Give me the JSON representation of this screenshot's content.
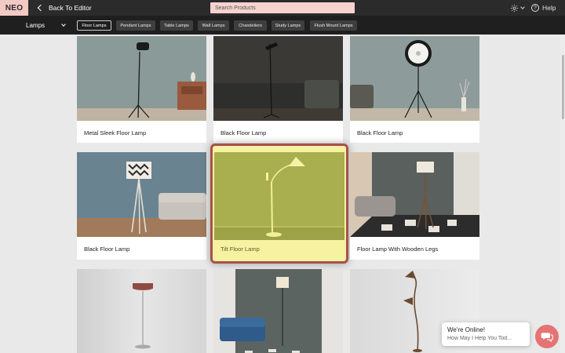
{
  "header": {
    "logo": "NEO",
    "back_label": "Back To Editor",
    "search_placeholder": "Search Products",
    "help_label": "Help"
  },
  "category_bar": {
    "selected_category": "Lamps",
    "tabs": [
      {
        "label": "Floor Lamps",
        "active": true
      },
      {
        "label": "Pendant Lamps",
        "active": false
      },
      {
        "label": "Table Lamps",
        "active": false
      },
      {
        "label": "Wall Lamps",
        "active": false
      },
      {
        "label": "Chandeliers",
        "active": false
      },
      {
        "label": "Study Lamps",
        "active": false
      },
      {
        "label": "Flush Mount Lamps",
        "active": false
      }
    ]
  },
  "products": [
    {
      "title": "Metal Sleek Floor Lamp"
    },
    {
      "title": "Black Floor Lamp"
    },
    {
      "title": "Black Floor Lamp"
    },
    {
      "title": "Black Floor Lamp"
    },
    {
      "title": "Tilt Floor Lamp",
      "highlighted": true
    },
    {
      "title": "Floor Lamp With Wooden Legs"
    },
    {
      "title": ""
    },
    {
      "title": ""
    },
    {
      "title": ""
    }
  ],
  "chat": {
    "title": "We're Online!",
    "subtitle": "How May I Help You Tod..."
  },
  "colors": {
    "topbar": "#2b2b2b",
    "logo_bg": "#f3c9c4",
    "search_bg": "#f6d3cf",
    "highlight_border": "#a8514a",
    "highlight_fill": "#f6f2a2",
    "chat_button": "#e57373"
  }
}
